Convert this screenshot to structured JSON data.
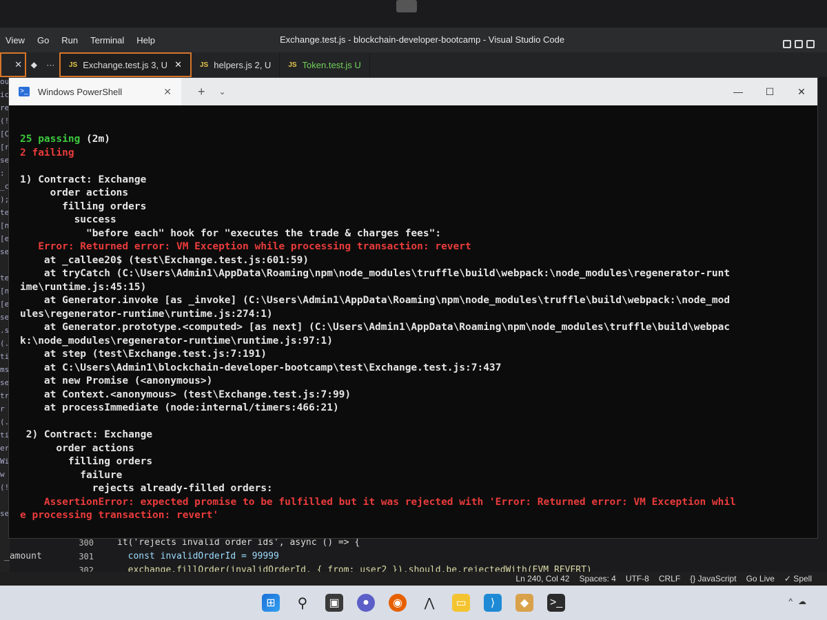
{
  "vscode": {
    "menu": [
      "View",
      "Go",
      "Run",
      "Terminal",
      "Help"
    ],
    "window_title": "Exchange.test.js - blockchain-developer-bootcamp - Visual Studio Code",
    "tab_stub_close": "✕",
    "tab_icons": [
      "◆",
      "···"
    ],
    "tabs": [
      {
        "icon": "JS",
        "label": "Exchange.test.js 3, U",
        "close": "✕"
      },
      {
        "icon": "JS",
        "label": "helpers.js 2, U"
      },
      {
        "icon": "JS",
        "label": "Token.test.js U"
      }
    ],
    "sidebar_fragments": [
      "ou",
      "ic",
      "re",
      "(!",
      "[C",
      "[r",
      "se",
      ":",
      "_c",
      ");",
      "te",
      "[n",
      "[e",
      "se",
      "",
      "te",
      "[n",
      "[e",
      "se",
      ".s",
      "(.",
      "ti",
      "ms",
      "se",
      "tr",
      "r",
      "(.",
      "ti",
      "er",
      "Wi",
      "w",
      "(!",
      "",
      "se"
    ],
    "amount_label": "_amount",
    "line_numbers": [
      "300",
      "301",
      "302"
    ],
    "code_lines": [
      "it('rejects invalid order ids', async () => {",
      "  const invalidOrderId = 99999",
      "  exchange.fillOrder(invalidOrderId, { from: user2 }).should.be.rejectedWith(EVM_REVERT)"
    ],
    "status": [
      "Ln 240, Col 42",
      "Spaces: 4",
      "UTF-8",
      "CRLF",
      "{} JavaScript",
      "Go Live",
      "✓ Spell"
    ]
  },
  "powershell": {
    "tab_title": "Windows PowerShell",
    "tab_icon": ">_",
    "tab_close": "✕",
    "new_tab": "+",
    "dropdown": "⌄",
    "window_controls": [
      "—",
      "☐",
      "✕"
    ],
    "passing": "25 passing",
    "passing_time": " (2m)",
    "failing": "2 failing",
    "output": [
      {
        "text": "",
        "cls": ""
      },
      {
        "text": "1) Contract: Exchange",
        "cls": "",
        "indent": 0
      },
      {
        "text": "     order actions",
        "cls": ""
      },
      {
        "text": "       filling orders",
        "cls": ""
      },
      {
        "text": "         success",
        "cls": ""
      },
      {
        "text": "           \"before each\" hook for \"executes the trade & charges fees\":",
        "cls": ""
      },
      {
        "text": "   Error: Returned error: VM Exception while processing transaction: revert",
        "cls": "err"
      },
      {
        "text": "    at _callee20$ (test\\Exchange.test.js:601:59)",
        "cls": ""
      },
      {
        "text": "    at tryCatch (C:\\Users\\Admin1\\AppData\\Roaming\\npm\\node_modules\\truffle\\build\\webpack:\\node_modules\\regenerator-runt",
        "cls": ""
      },
      {
        "text": "ime\\runtime.js:45:15)",
        "cls": ""
      },
      {
        "text": "    at Generator.invoke [as _invoke] (C:\\Users\\Admin1\\AppData\\Roaming\\npm\\node_modules\\truffle\\build\\webpack:\\node_mod",
        "cls": ""
      },
      {
        "text": "ules\\regenerator-runtime\\runtime.js:274:1)",
        "cls": ""
      },
      {
        "text": "    at Generator.prototype.<computed> [as next] (C:\\Users\\Admin1\\AppData\\Roaming\\npm\\node_modules\\truffle\\build\\webpac",
        "cls": ""
      },
      {
        "text": "k:\\node_modules\\regenerator-runtime\\runtime.js:97:1)",
        "cls": ""
      },
      {
        "text": "    at step (test\\Exchange.test.js:7:191)",
        "cls": ""
      },
      {
        "text": "    at C:\\Users\\Admin1\\blockchain-developer-bootcamp\\test\\Exchange.test.js:7:437",
        "cls": ""
      },
      {
        "text": "    at new Promise (<anonymous>)",
        "cls": ""
      },
      {
        "text": "    at Context.<anonymous> (test\\Exchange.test.js:7:99)",
        "cls": ""
      },
      {
        "text": "    at processImmediate (node:internal/timers:466:21)",
        "cls": ""
      },
      {
        "text": "",
        "cls": ""
      },
      {
        "text": " 2) Contract: Exchange",
        "cls": ""
      },
      {
        "text": "      order actions",
        "cls": ""
      },
      {
        "text": "        filling orders",
        "cls": ""
      },
      {
        "text": "          failure",
        "cls": ""
      },
      {
        "text": "            rejects already-filled orders:",
        "cls": ""
      },
      {
        "text": "    AssertionError: expected promise to be fulfilled but it was rejected with 'Error: Returned error: VM Exception whil",
        "cls": "err"
      },
      {
        "text": "e processing transaction: revert'",
        "cls": "err"
      }
    ]
  },
  "taskbar": {
    "icons": [
      {
        "name": "windows-start-icon",
        "glyph": "⊞",
        "cls": "tb-start"
      },
      {
        "name": "search-icon",
        "glyph": "⚲",
        "cls": "tb-search"
      },
      {
        "name": "task-view-icon",
        "glyph": "▣",
        "cls": "tb-view"
      },
      {
        "name": "meet-icon",
        "glyph": "●",
        "cls": "tb-meet"
      },
      {
        "name": "firefox-icon",
        "glyph": "◉",
        "cls": "tb-firefox"
      },
      {
        "name": "predator-sense-icon",
        "glyph": "⋀",
        "cls": "tb-predator"
      },
      {
        "name": "file-explorer-icon",
        "glyph": "▭",
        "cls": "tb-folder"
      },
      {
        "name": "vscode-icon",
        "glyph": "⟩",
        "cls": "tb-vscode"
      },
      {
        "name": "package-icon",
        "glyph": "◆",
        "cls": "tb-box"
      },
      {
        "name": "terminal-icon",
        "glyph": ">_",
        "cls": "tb-term"
      }
    ],
    "tray": [
      "^",
      "☁"
    ]
  }
}
